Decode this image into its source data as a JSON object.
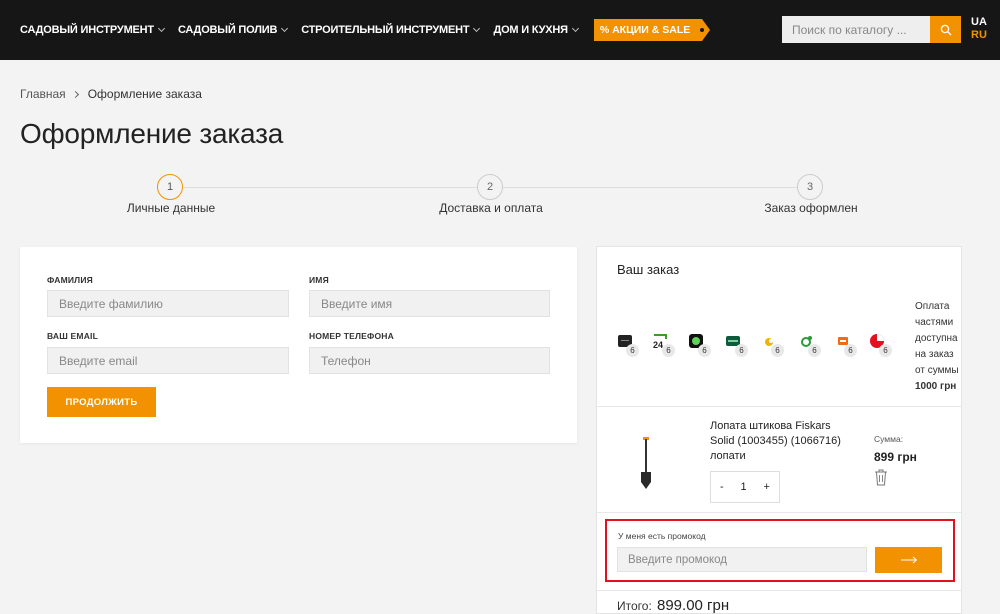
{
  "header": {
    "nav": [
      {
        "label": "САДОВЫЙ ИНСТРУМЕНТ"
      },
      {
        "label": "САДОВЫЙ ПОЛИВ"
      },
      {
        "label": "СТРОИТЕЛЬНЫЙ ИНСТРУМЕНТ"
      },
      {
        "label": "ДОМ И КУХНЯ"
      }
    ],
    "sale_label": "% АКЦИИ & SALE",
    "search_placeholder": "Поиск по каталогу ...",
    "lang_ua": "UA",
    "lang_ru": "RU",
    "accent_color": "#f39200"
  },
  "breadcrumb": {
    "home": "Главная",
    "current": "Оформление заказа"
  },
  "page_title": "Оформление заказа",
  "steps": [
    {
      "num": "1",
      "label": "Личные данные"
    },
    {
      "num": "2",
      "label": "Доставка и оплата"
    },
    {
      "num": "3",
      "label": "Заказ оформлен"
    }
  ],
  "form": {
    "last_name_label": "ФАМИЛИЯ",
    "last_name_placeholder": "Введите фамилию",
    "first_name_label": "ИМЯ",
    "first_name_placeholder": "Введите имя",
    "email_label": "ВАШ EMAIL",
    "email_placeholder": "Введите email",
    "phone_label": "НОМЕР ТЕЛЕФОНА",
    "phone_placeholder": "Телефон",
    "continue_label": "ПРОДОЛЖИТЬ"
  },
  "order": {
    "title": "Ваш заказ",
    "installment_banks": [
      {
        "name": "monobank",
        "count": "6"
      },
      {
        "name": "privatbank",
        "count": "6"
      },
      {
        "name": "abank",
        "count": "6"
      },
      {
        "name": "pumb",
        "count": "6"
      },
      {
        "name": "sense-bank",
        "count": "6"
      },
      {
        "name": "oschadbank",
        "count": "6"
      },
      {
        "name": "otp-bank",
        "count": "6"
      },
      {
        "name": "ukrsibbank",
        "count": "6"
      }
    ],
    "installment_note": "Оплата частями доступна на заказ от суммы",
    "installment_min": "1000 грн",
    "product": {
      "name": "Лопата штикова Fiskars Solid (1003455) (1066716) лопати",
      "sum_label": "Сумма:",
      "price": "899 грн",
      "qty": "1",
      "minus": "-",
      "plus": "+"
    },
    "promo": {
      "label": "У меня есть промокод",
      "placeholder": "Введите промокод"
    },
    "total_label": "Итого:",
    "total_value": "899.00 грн"
  }
}
